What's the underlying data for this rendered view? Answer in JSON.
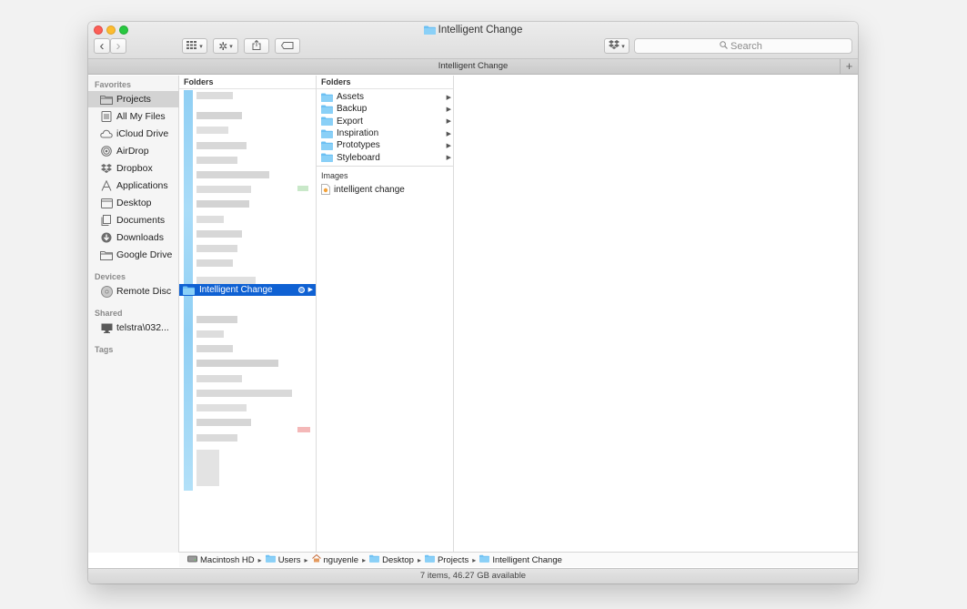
{
  "window": {
    "title": "Intelligent Change"
  },
  "toolbar": {
    "back_label": "‹",
    "forward_label": "›",
    "view_icon": "grid-view-icon",
    "action_icon": "gear-icon",
    "share_icon": "share-icon",
    "tags_icon": "tag-icon",
    "dropbox_icon": "dropbox-icon",
    "search_placeholder": "Search"
  },
  "tab": {
    "label": "Intelligent Change",
    "add_label": "+"
  },
  "sidebar": {
    "favorites_label": "Favorites",
    "favorites": [
      {
        "label": "Projects",
        "icon": "folder-icon"
      },
      {
        "label": "All My Files",
        "icon": "all-files-icon"
      },
      {
        "label": "iCloud Drive",
        "icon": "cloud-icon"
      },
      {
        "label": "AirDrop",
        "icon": "airdrop-icon"
      },
      {
        "label": "Dropbox",
        "icon": "dropbox-icon"
      },
      {
        "label": "Applications",
        "icon": "applications-icon"
      },
      {
        "label": "Desktop",
        "icon": "desktop-icon"
      },
      {
        "label": "Documents",
        "icon": "documents-icon"
      },
      {
        "label": "Downloads",
        "icon": "downloads-icon"
      },
      {
        "label": "Google Drive",
        "icon": "folder-icon"
      }
    ],
    "devices_label": "Devices",
    "devices": [
      {
        "label": "Remote Disc",
        "icon": "disc-icon"
      }
    ],
    "shared_label": "Shared",
    "shared": [
      {
        "label": "telstra\\032...",
        "icon": "computer-icon"
      }
    ],
    "tags_label": "Tags"
  },
  "column1": {
    "header": "Folders",
    "selected_item": "Intelligent Change"
  },
  "column2": {
    "header": "Folders",
    "folders": [
      "Assets",
      "Backup",
      "Export",
      "Inspiration",
      "Prototypes",
      "Styleboard"
    ],
    "images_header": "Images",
    "images": [
      "intelligent change"
    ]
  },
  "pathbar": {
    "items": [
      "Macintosh HD",
      "Users",
      "nguyenle",
      "Desktop",
      "Projects",
      "Intelligent Change"
    ],
    "separator": "▸"
  },
  "status": {
    "text": "7 items, 46.27 GB available"
  },
  "colors": {
    "selection": "#0f61d3",
    "folder": "#6cc0f3"
  }
}
